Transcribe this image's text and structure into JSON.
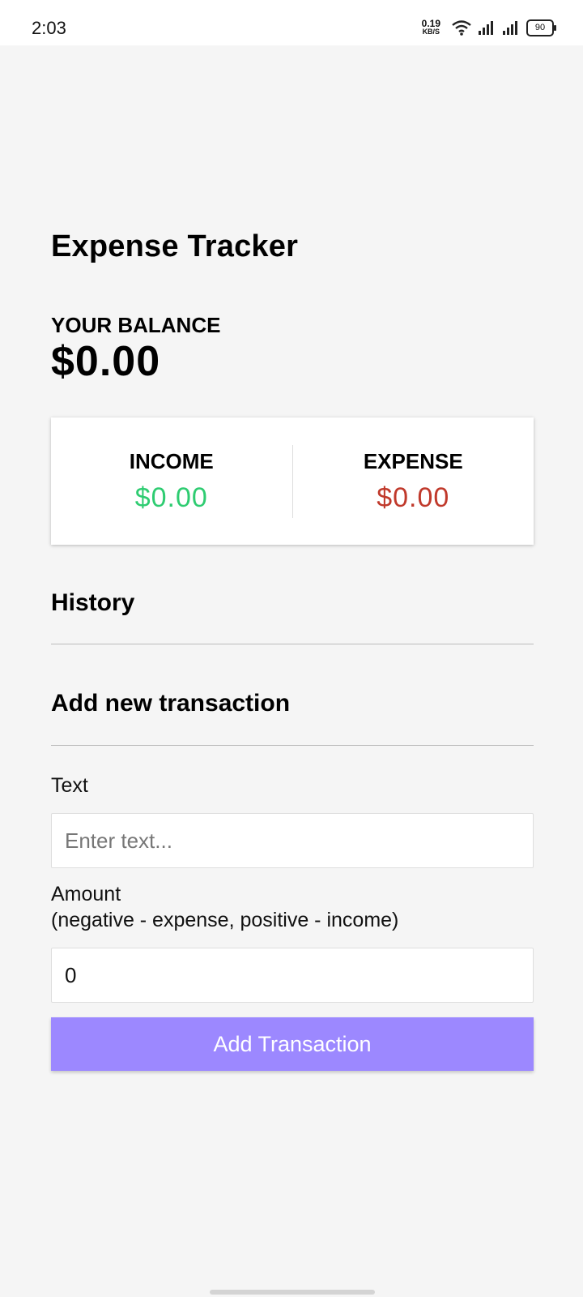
{
  "status_bar": {
    "time": "2:03",
    "net_speed_value": "0.19",
    "net_speed_unit": "KB/S",
    "battery": "90",
    "icons": [
      "wifi-icon",
      "signal-icon",
      "signal-icon",
      "battery-icon"
    ]
  },
  "app": {
    "title": "Expense Tracker",
    "balance_label": "YOUR BALANCE",
    "balance_amount": "$0.00"
  },
  "summary": {
    "income_label": "INCOME",
    "income_amount": "$0.00",
    "expense_label": "EXPENSE",
    "expense_amount": "$0.00"
  },
  "history": {
    "heading": "History",
    "items": []
  },
  "add_transaction": {
    "heading": "Add new transaction",
    "text_label": "Text",
    "text_placeholder": "Enter text...",
    "text_value": "",
    "amount_label_line1": "Amount",
    "amount_label_line2": "(negative - expense, positive - income)",
    "amount_value": "0",
    "button_label": "Add Transaction"
  },
  "colors": {
    "income": "#2ecc71",
    "expense": "#c0392b",
    "button": "#9c88ff",
    "background": "#f5f5f5"
  }
}
